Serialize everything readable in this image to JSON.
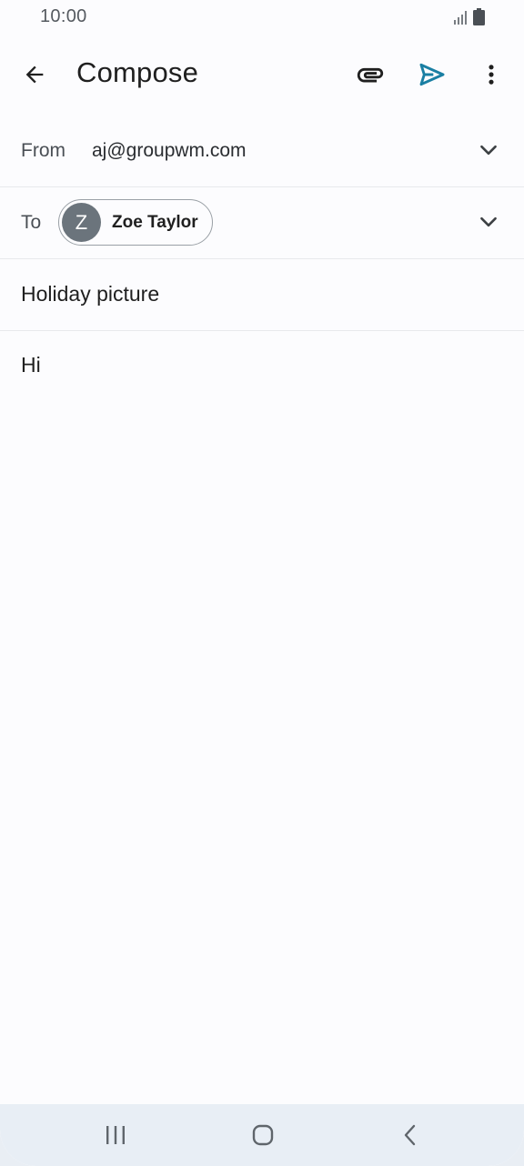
{
  "status_bar": {
    "time": "10:00",
    "signal_icon": "signal-icon",
    "battery_icon": "battery-icon"
  },
  "app_bar": {
    "title": "Compose",
    "back_icon": "arrow-back-icon",
    "attach_icon": "paperclip-icon",
    "send_icon": "send-icon",
    "more_icon": "more-vertical-icon",
    "accent_color": "#1a7fa3"
  },
  "from": {
    "label": "From",
    "value": "aj@groupwm.com"
  },
  "to": {
    "label": "To",
    "recipient_initial": "Z",
    "recipient_name": "Zoe Taylor"
  },
  "subject": {
    "value": "Holiday picture"
  },
  "body": {
    "value": "Hi"
  },
  "nav_bar": {
    "recents_icon": "recents-icon",
    "home_icon": "home-icon",
    "back_icon": "nav-back-icon"
  }
}
